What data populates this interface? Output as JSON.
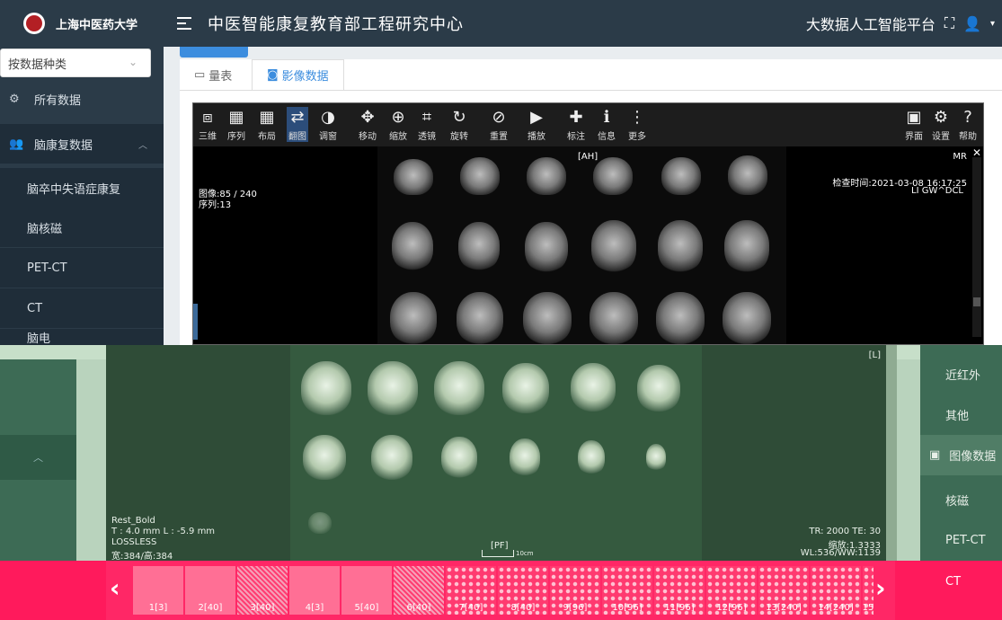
{
  "header": {
    "university": "上海中医药大学",
    "title": "中医智能康复教育部工程研究中心",
    "platform": "大数据人工智能平台"
  },
  "sidebar": {
    "select_value": "按数据种类",
    "items": [
      {
        "label": "所有数据"
      },
      {
        "label": "脑康复数据"
      },
      {
        "label": "脑卒中失语症康复"
      },
      {
        "label": "脑核磁"
      },
      {
        "label": "PET-CT"
      },
      {
        "label": "CT"
      },
      {
        "label": "脑电"
      }
    ]
  },
  "tabs": [
    {
      "label": "量表"
    },
    {
      "label": "影像数据"
    }
  ],
  "toolbar": {
    "tools": [
      "三维",
      "序列",
      "布局",
      "翻图",
      "调窗",
      "移动",
      "缩放",
      "透镜",
      "旋转",
      "重置",
      "播放",
      "标注",
      "信息",
      "更多"
    ],
    "right_tools": [
      "界面",
      "设置",
      "帮助"
    ]
  },
  "viewer": {
    "image_counter": "图像:85 / 240",
    "series": "序列:13",
    "orientation_top": "[AH]",
    "modality": "MR",
    "exam_time": "检查时间:2021-03-08 16:17:25",
    "patient": "LI GW^DCL",
    "orientation_right": "[L]",
    "protocol": "Rest_Bold",
    "thickness": "T : 4.0 mm L : -5.9 mm",
    "compression": "LOSSLESS",
    "dimensions": "宽:384/高:384",
    "scale_label": "[PF]",
    "scale_unit": "10cm",
    "tr_te": "TR: 2000 TE: 30",
    "zoom": "缩放:1.3333",
    "window": "WL:536/WW:1139"
  },
  "right_panel": {
    "items": [
      "近红外",
      "其他",
      "图像数据",
      "核磁",
      "PET-CT",
      "CT"
    ]
  },
  "filmstrip": {
    "labels": [
      "1[3]",
      "2[40]",
      "3[40]",
      "4[3]",
      "5[40]",
      "6[40]",
      "7[40]",
      "8[40]",
      "9[96]",
      "10[96]",
      "11[96]",
      "12[96]",
      "13[240]",
      "14[240]",
      "15"
    ]
  }
}
